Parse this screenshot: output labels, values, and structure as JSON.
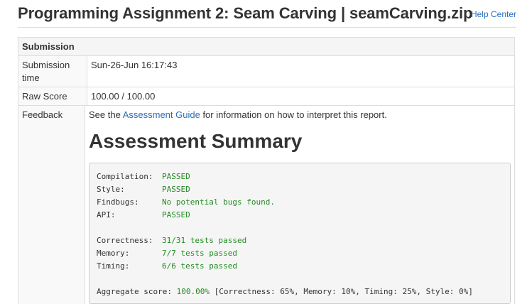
{
  "header": {
    "title": "Programming Assignment 2: Seam Carving | seamCarving.zip",
    "help_link": "Help Center"
  },
  "submission": {
    "heading": "Submission",
    "rows": {
      "time_label": "Submission time",
      "time_value": "Sun-26-Jun 16:17:43",
      "score_label": "Raw Score",
      "score_value": "100.00 / 100.00",
      "feedback_label": "Feedback"
    }
  },
  "feedback": {
    "intro_before": "See the ",
    "intro_link": "Assessment Guide",
    "intro_after": " for information on how to interpret this report.",
    "summary_title": "Assessment Summary",
    "lines": {
      "compilation_label": "Compilation:",
      "compilation_value": "PASSED",
      "style_label": "Style:",
      "style_value": "PASSED",
      "findbugs_label": "Findbugs:",
      "findbugs_value": "No potential bugs found.",
      "api_label": "API:",
      "api_value": "PASSED",
      "correctness_label": "Correctness:",
      "correctness_value": "31/31 tests passed",
      "memory_label": "Memory:",
      "memory_value": "7/7 tests passed",
      "timing_label": "Timing:",
      "timing_value": "6/6 tests passed",
      "aggregate_label": "Aggregate score: ",
      "aggregate_value": "100.00%",
      "aggregate_breakdown": " [Correctness: 65%, Memory: 10%, Timing: 25%, Style: 0%]"
    }
  },
  "colors": {
    "link": "#2a6ebb",
    "pass": "#228b22",
    "text": "#333333"
  }
}
